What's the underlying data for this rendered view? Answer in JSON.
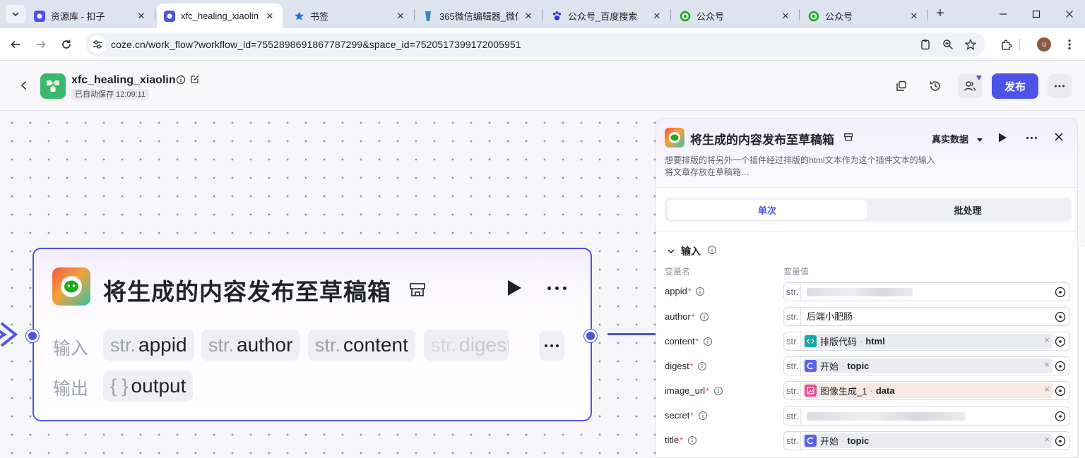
{
  "browser": {
    "tabs": [
      {
        "title": "资源库 - 扣子",
        "close": "✕"
      },
      {
        "title": "xfc_healing_xiaolin",
        "close": "✕"
      },
      {
        "title": "书签",
        "close": "✕"
      },
      {
        "title": "365微信编辑器_微信",
        "close": "✕"
      },
      {
        "title": "公众号_百度搜索",
        "close": "✕"
      },
      {
        "title": "公众号",
        "close": "✕"
      },
      {
        "title": "公众号",
        "close": "✕"
      }
    ],
    "new_tab": "+",
    "url": "coze.cn/work_flow?workflow_id=7552898691867787299&space_id=7520517399172005951",
    "profile_initial": "u"
  },
  "header": {
    "workflow_name": "xfc_healing_xiaolin",
    "autosave": "已自动保存 12:09:11",
    "publish": "发布"
  },
  "node": {
    "title": "将生成的内容发布至草稿箱",
    "input_label": "输入",
    "output_label": "输出",
    "inputs": [
      {
        "type": "str.",
        "name": "appid"
      },
      {
        "type": "str.",
        "name": "author"
      },
      {
        "type": "str.",
        "name": "content"
      },
      {
        "type": "str.",
        "name": "digest"
      }
    ],
    "outputs": [
      {
        "type": "{ }",
        "name": "output"
      }
    ]
  },
  "panel": {
    "title": "将生成的内容发布至草稿箱",
    "data_mode": "真实数据",
    "description_line1": "想要排版的将另外一个插件经过排版的html文本作为这个插件文本的输入",
    "description_line2": "将文章存放在草稿箱…",
    "tabs": [
      "单次",
      "批处理"
    ],
    "section": "输入",
    "col_name": "变量名",
    "col_value": "变量值",
    "required_mark": "*",
    "type_label": "str.",
    "params": [
      {
        "name": "appid",
        "kind": "blurred",
        "value": ""
      },
      {
        "name": "author",
        "kind": "text",
        "value": "后端小肥肠"
      },
      {
        "name": "content",
        "kind": "ref",
        "source": "排版代码",
        "attr": "html",
        "icon_color": "#13a8a8"
      },
      {
        "name": "digest",
        "kind": "ref",
        "source": "开始",
        "attr": "topic",
        "icon_color": "#5a5ff0"
      },
      {
        "name": "image_url",
        "kind": "ref",
        "source": "图像生成_1",
        "attr": "data",
        "icon_color": "#e84b9a"
      },
      {
        "name": "secret",
        "kind": "blurred",
        "value": ""
      },
      {
        "name": "title",
        "kind": "ref",
        "source": "开始",
        "attr": "topic",
        "icon_color": "#5a5ff0"
      }
    ]
  },
  "colors": {
    "accent": "#4d53e8",
    "required": "#e5484d"
  }
}
